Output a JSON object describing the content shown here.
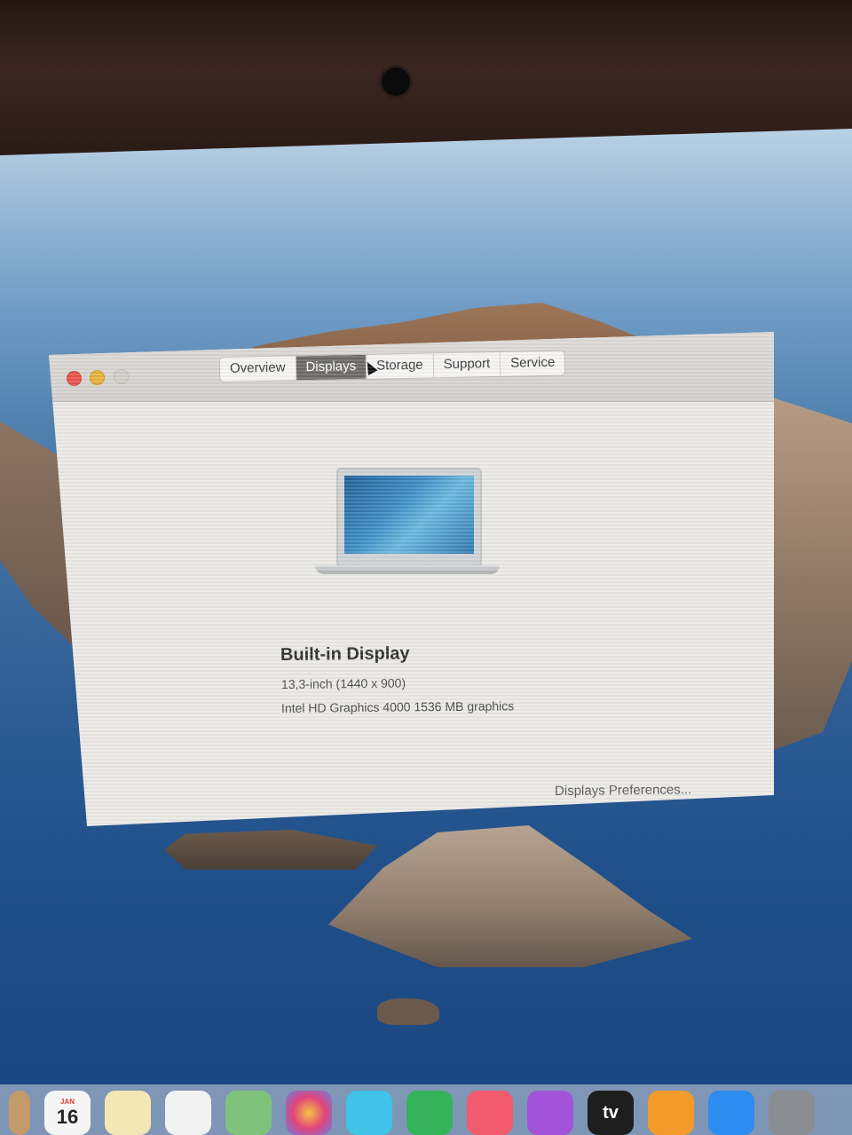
{
  "window": {
    "tabs": [
      {
        "label": "Overview",
        "active": false
      },
      {
        "label": "Displays",
        "active": true
      },
      {
        "label": "Storage",
        "active": false
      },
      {
        "label": "Support",
        "active": false
      },
      {
        "label": "Service",
        "active": false
      }
    ],
    "display": {
      "title": "Built-in Display",
      "size_resolution": "13,3-inch (1440 x 900)",
      "graphics": "Intel HD Graphics 4000 1536 MB graphics"
    },
    "preferences_button": "Displays Preferences..."
  },
  "dock": {
    "calendar": {
      "month": "JAN",
      "day": "16"
    },
    "apps": [
      "finder-icon",
      "calendar-icon",
      "notes-icon",
      "reminders-icon",
      "maps-icon",
      "photos-icon",
      "messages-icon",
      "facetime-icon",
      "music-icon",
      "podcasts-icon",
      "tv-icon",
      "books-icon",
      "app-store-icon",
      "system-preferences-icon"
    ],
    "tv_label": "tv"
  },
  "colors": {
    "active_tab": "#6c6a67",
    "close": "#e8524a",
    "minimize": "#e7b23d",
    "zoom_disabled": "#d0cdc9"
  }
}
